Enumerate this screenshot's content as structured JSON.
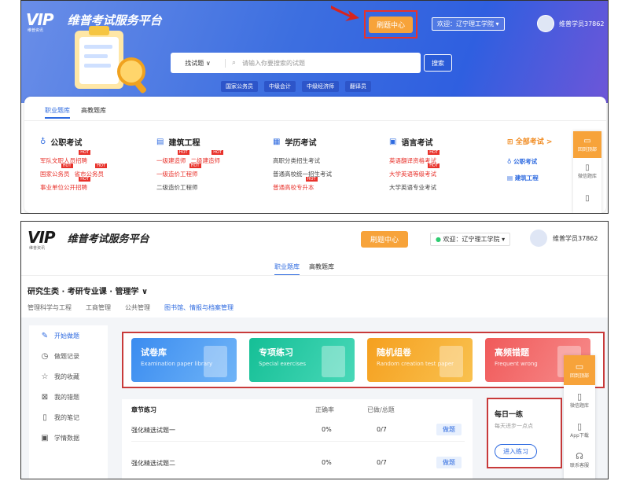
{
  "shot1": {
    "logo_text": "VIP",
    "logo_sub": "维普资讯",
    "brand": "维普考试服务平台",
    "question_center": "刷题中心",
    "welcome": "欢迎：辽宁理工学院 ▾",
    "username": "维普学员37862",
    "search_select": "找试题 ∨",
    "search_placeholder": "请输入你要搜索的试题",
    "search_button": "搜索",
    "tags": [
      "国家公务员",
      "中级会计",
      "中级经济师",
      "翻译员"
    ],
    "tabs": [
      "职业题库",
      "高教题库"
    ],
    "columns": [
      {
        "icon": "♁",
        "title": "公职考试",
        "rows": [
          [
            "军队文职人员招聘"
          ],
          [
            "国家公务员",
            "省市公务员"
          ],
          [
            "事业单位公开招聘"
          ]
        ]
      },
      {
        "icon": "▤",
        "title": "建筑工程",
        "rows": [
          [
            "一级建造师",
            "二级建造师"
          ],
          [
            "一级造价工程师"
          ],
          [
            "二级造价工程师"
          ]
        ]
      },
      {
        "icon": "▦",
        "title": "学历考试",
        "rows": [
          [
            "高职分类招生考试"
          ],
          [
            "普通高校统一招生考试"
          ],
          [
            "普通高校专升本"
          ]
        ]
      },
      {
        "icon": "▣",
        "title": "语言考试",
        "rows": [
          [
            "英语翻译资格考试"
          ],
          [
            "大学英语等级考试"
          ],
          [
            "大学英语专业考试"
          ]
        ]
      }
    ],
    "all_exams": "全部考试 >",
    "all_sub": [
      "公职考试",
      "建筑工程"
    ],
    "side": [
      "回到顶部",
      "微信题库",
      "App下载"
    ]
  },
  "shot2": {
    "logo_text": "VIP",
    "logo_sub": "维普资讯",
    "brand": "维普考试服务平台",
    "question_center": "刷题中心",
    "welcome": "欢迎：辽宁理工学院 ▾",
    "username": "维普学员37862",
    "tabs": [
      "职业题库",
      "高教题库"
    ],
    "breadcrumb": "研究生类 · 考研专业课 · 管理学  ∨",
    "subtabs": [
      "管理科学与工程",
      "工商管理",
      "公共管理",
      "图书馆、情报与档案管理"
    ],
    "nav": [
      {
        "icon": "✎",
        "label": "开始做题"
      },
      {
        "icon": "◷",
        "label": "做题记录"
      },
      {
        "icon": "☆",
        "label": "我的收藏"
      },
      {
        "icon": "⊠",
        "label": "我的错题"
      },
      {
        "icon": "▯",
        "label": "我的笔记"
      },
      {
        "icon": "▣",
        "label": "学情数据"
      }
    ],
    "tiles": [
      {
        "title": "试卷库",
        "sub": "Examination paper library",
        "color": "#4a9cf0"
      },
      {
        "title": "专项练习",
        "sub": "Special exercises",
        "color": "#22c7a5"
      },
      {
        "title": "随机组卷",
        "sub": "Random creation test paper",
        "color": "#f7a82a"
      },
      {
        "title": "高频错题",
        "sub": "Frequent wrong",
        "color": "#f26a6a"
      }
    ],
    "practice": {
      "headers": [
        "章节练习",
        "正确率",
        "已做/总题"
      ],
      "rows": [
        {
          "name": "强化精选试题一",
          "rate": "0%",
          "done": "0/7",
          "action": "做题"
        },
        {
          "name": "强化精选试题二",
          "rate": "0%",
          "done": "0/7",
          "action": "做题"
        }
      ]
    },
    "daily": {
      "title": "每日一练",
      "sub": "每天进步一点点",
      "button": "进入练习"
    },
    "side": [
      "回到顶部",
      "微信题库",
      "App下载",
      "联系客服"
    ]
  }
}
